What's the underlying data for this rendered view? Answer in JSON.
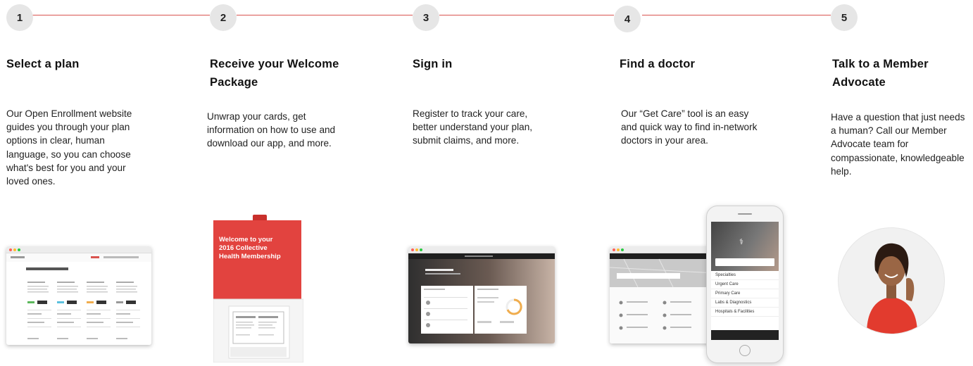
{
  "steps": [
    {
      "number": "1",
      "title": "Select a plan",
      "description": "Our Open Enrollment website guides you through your plan options in clear, human language, so you can choose what's best for you and your loved ones.",
      "image": "plan-comparison-screenshot"
    },
    {
      "number": "2",
      "title": "Receive your Welcome Package",
      "description": "Unwrap your cards, get information on how to use and download our app, and more.",
      "image": "welcome-package-box",
      "package_text": "Welcome to your 2016 Collective Health Membership"
    },
    {
      "number": "3",
      "title": "Sign in",
      "description": "Register to track your care, better understand your plan, submit claims, and more.",
      "image": "member-portal-screenshot"
    },
    {
      "number": "4",
      "title": "Find a doctor",
      "description": "Our “Get Care” tool is an easy and quick way to find in-network doctors in your area.",
      "image": "get-care-desktop-and-phone",
      "phone_items": [
        "Specialties",
        "Urgent Care",
        "Primary Care",
        "Labs & Diagnostics",
        "Hospitals & Facilities"
      ]
    },
    {
      "number": "5",
      "title": "Talk to a Member Advocate",
      "description": "Have a question that just needs a human? Call our Member Advocate team for compassionate, knowledgeable help.",
      "image": "member-advocate-photo"
    }
  ],
  "colors": {
    "accent": "#d9534f",
    "circle": "#e6e6e6",
    "package_red": "#e2433f"
  }
}
